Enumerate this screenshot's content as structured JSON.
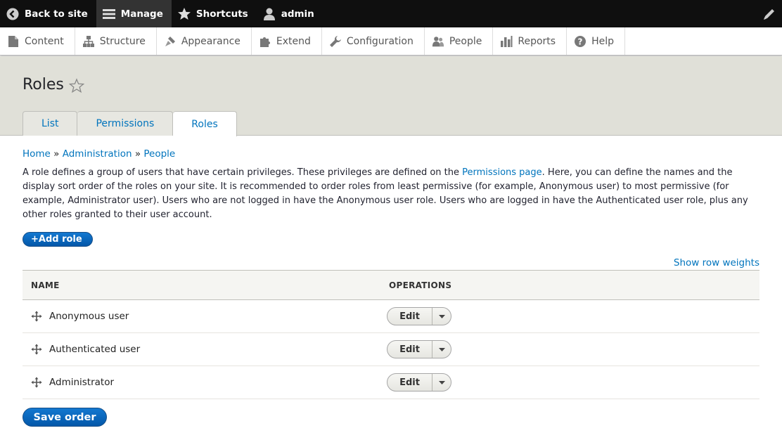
{
  "toolbar": {
    "back_label": "Back to site",
    "manage_label": "Manage",
    "shortcuts_label": "Shortcuts",
    "user_label": "admin"
  },
  "tray": {
    "items": [
      {
        "label": "Content",
        "icon": "content-icon"
      },
      {
        "label": "Structure",
        "icon": "structure-icon"
      },
      {
        "label": "Appearance",
        "icon": "appearance-icon"
      },
      {
        "label": "Extend",
        "icon": "extend-icon"
      },
      {
        "label": "Configuration",
        "icon": "configuration-icon"
      },
      {
        "label": "People",
        "icon": "people-icon"
      },
      {
        "label": "Reports",
        "icon": "reports-icon"
      },
      {
        "label": "Help",
        "icon": "help-icon"
      }
    ]
  },
  "header": {
    "title": "Roles",
    "tabs": [
      {
        "label": "List",
        "active": false
      },
      {
        "label": "Permissions",
        "active": false
      },
      {
        "label": "Roles",
        "active": true
      }
    ]
  },
  "breadcrumb": {
    "home": "Home",
    "sep": "»",
    "administration": "Administration",
    "people": "People"
  },
  "description": {
    "before_link": "A role defines a group of users that have certain privileges. These privileges are defined on the ",
    "link": "Permissions page",
    "after_link": ". Here, you can define the names and the display sort order of the roles on your site. It is recommended to order roles from least permissive (for example, Anonymous user) to most permissive (for example, Administrator user). Users who are not logged in have the Anonymous user role. Users who are logged in have the Authenticated user role, plus any other roles granted to their user account."
  },
  "actions": {
    "add_role": "+Add role",
    "show_row_weights": "Show row weights",
    "save_order": "Save order"
  },
  "table": {
    "columns": [
      "NAME",
      "OPERATIONS"
    ],
    "rows": [
      {
        "name": "Anonymous user",
        "op": "Edit"
      },
      {
        "name": "Authenticated user",
        "op": "Edit"
      },
      {
        "name": "Administrator",
        "op": "Edit"
      }
    ]
  },
  "colors": {
    "link": "#0074bd",
    "primary_button": "#0a63b5",
    "toolbar_bg": "#0f0f0f",
    "header_bg": "#e0e0d8"
  }
}
